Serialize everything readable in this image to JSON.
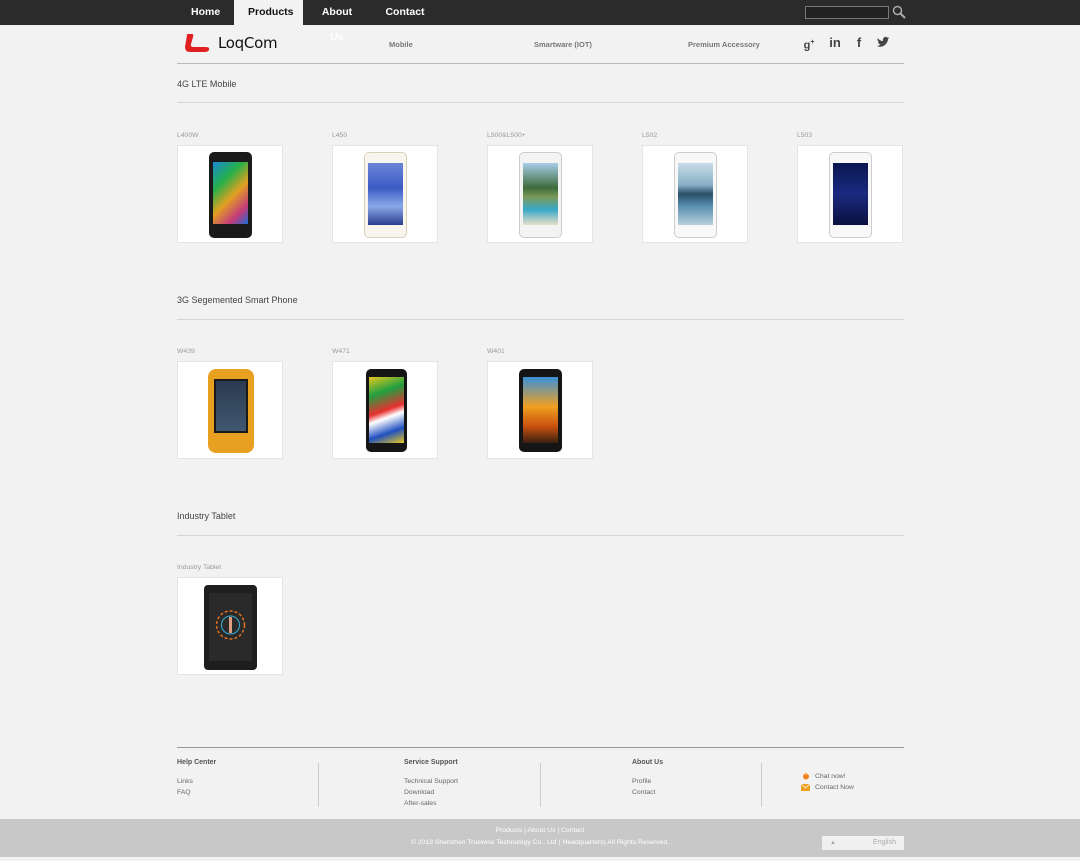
{
  "topnav": {
    "items": [
      {
        "label": "Home",
        "active": false
      },
      {
        "label": "Products",
        "active": true
      },
      {
        "label": "About Us",
        "active": false
      },
      {
        "label": "Contact",
        "active": false
      }
    ]
  },
  "brand": {
    "name": "LoqCom",
    "accent": "#e02020"
  },
  "subnav": [
    "Mobile",
    "Smartware (IOT)",
    "Premium Accessory"
  ],
  "social": [
    "google-plus-icon",
    "linkedin-icon",
    "facebook-icon",
    "twitter-icon"
  ],
  "sections": [
    {
      "title": "4G LTE Mobile",
      "products": [
        "L400W",
        "L450",
        "L500&L500+",
        "L502",
        "L503"
      ]
    },
    {
      "title": "3G Segemented Smart Phone",
      "products": [
        "W439",
        "W471",
        "W401"
      ]
    },
    {
      "title": "Industry Tablet",
      "products": [
        "Industry Tablet"
      ]
    }
  ],
  "footer": {
    "columns": [
      {
        "title": "Help Center",
        "links": [
          "Links",
          "FAQ"
        ]
      },
      {
        "title": "Service Support",
        "links": [
          "Technical Support",
          "Download",
          "After-sales"
        ]
      },
      {
        "title": "About Us",
        "links": [
          "Profile",
          "Contact"
        ]
      }
    ],
    "chat_label": "Chat now!",
    "contact_label": "Contact Now",
    "bottom_links": "Products | About Us | Contact",
    "copyright": "© 2013 Shenzhen Truewise Technology Co., Ltd ( Headquarters) All Rights Reserved.",
    "language": "English"
  }
}
